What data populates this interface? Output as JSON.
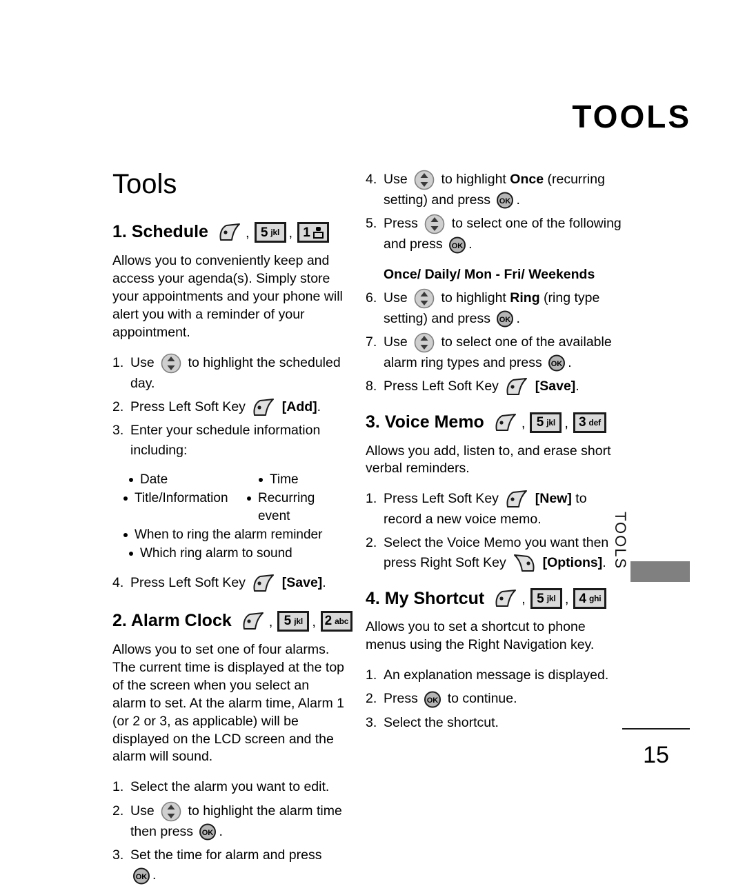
{
  "header": {
    "running_head": "TOOLS"
  },
  "chapter": {
    "title": "Tools"
  },
  "side_tab": {
    "label": "TOOLS",
    "bar_color": "#808080"
  },
  "footer": {
    "page_number": "15"
  },
  "sections": {
    "schedule": {
      "heading": "1. Schedule",
      "keys": [
        {
          "type": "softkey-left"
        },
        {
          "type": "keybox",
          "digit": "5",
          "letters": "jkl"
        },
        {
          "type": "keybox",
          "digit": "1",
          "glyph": "voicemail"
        }
      ],
      "body": "Allows you to conveniently keep and access your agenda(s). Simply store your appointments and your phone will alert you with a reminder of your appointment.",
      "step1_num": "1.",
      "step1_a": "Use",
      "step1_b": "to highlight the scheduled day.",
      "step2_num": "2.",
      "step2_a": "Press Left Soft Key",
      "step2_bracket": "[Add]",
      "step2_end": ".",
      "step3_num": "3.",
      "step3": "Enter your schedule information including:",
      "bullets": {
        "date": "Date",
        "time": "Time",
        "title_information": "Title/Information",
        "recurring_event": "Recurring event",
        "when_to_ring": "When to ring the alarm reminder",
        "which_ring": "Which ring alarm to sound"
      },
      "step4_num": "4.",
      "step4_a": "Press Left Soft Key",
      "step4_bracket": "[Save]",
      "step4_end": "."
    },
    "alarm_clock": {
      "heading": "2. Alarm Clock",
      "keys": [
        {
          "type": "softkey-left"
        },
        {
          "type": "keybox",
          "digit": "5",
          "letters": "jkl"
        },
        {
          "type": "keybox",
          "digit": "2",
          "letters": "abc"
        }
      ],
      "body": "Allows you to set one of four alarms. The current time is displayed at the top of the screen when you select an alarm to set. At the alarm time, Alarm 1 (or 2 or 3, as applicable) will be displayed on the LCD screen and the alarm will sound.",
      "step1_num": "1.",
      "step1": "Select the alarm you want to edit.",
      "step2_num": "2.",
      "step2_a": "Use",
      "step2_b": "to highlight the alarm time then press",
      "step2_end": ".",
      "step3_num": "3.",
      "step3_a": "Set the time for alarm and press",
      "step3_end": ".",
      "step4_num": "4.",
      "step4_a": "Use",
      "step4_b_bold": "Once",
      "step4_b_pre": "to highlight",
      "step4_c": "(recurring setting) and press",
      "step4_end": ".",
      "step5_num": "5.",
      "step5_a": "Press",
      "step5_b": "to select one of the following and press",
      "step5_end": ".",
      "step5_options": "Once/ Daily/ Mon - Fri/ Weekends",
      "step6_num": "6.",
      "step6_a": "Use",
      "step6_b_pre": "to highlight",
      "step6_b_bold": "Ring",
      "step6_c": "(ring type setting) and press",
      "step6_end": ".",
      "step7_num": "7.",
      "step7_a": "Use",
      "step7_b": "to select one of the available alarm ring types and press",
      "step7_end": ".",
      "step8_num": "8.",
      "step8_a": "Press Left Soft Key",
      "step8_bracket": "[Save]",
      "step8_end": "."
    },
    "voice_memo": {
      "heading": "3. Voice Memo",
      "keys": [
        {
          "type": "softkey-left"
        },
        {
          "type": "keybox",
          "digit": "5",
          "letters": "jkl"
        },
        {
          "type": "keybox",
          "digit": "3",
          "letters": "def"
        }
      ],
      "body": "Allows you add, listen to, and erase short verbal reminders.",
      "step1_num": "1.",
      "step1_a": "Press Left Soft Key",
      "step1_bracket": "[New]",
      "step1_b": "to record a new voice memo.",
      "step2_num": "2.",
      "step2_a": "Select the Voice Memo you want then press Right Soft Key",
      "step2_bracket": "[Options]",
      "step2_end": "."
    },
    "my_shortcut": {
      "heading": "4. My Shortcut",
      "keys": [
        {
          "type": "softkey-left"
        },
        {
          "type": "keybox",
          "digit": "5",
          "letters": "jkl"
        },
        {
          "type": "keybox",
          "digit": "4",
          "letters": "ghi"
        }
      ],
      "body": "Allows you to set a shortcut to phone menus using the Right Navigation key.",
      "step1_num": "1.",
      "step1": "An explanation message is displayed.",
      "step2_num": "2.",
      "step2_a": "Press",
      "step2_b": "to continue.",
      "step3_num": "3.",
      "step3": "Select the shortcut."
    }
  }
}
